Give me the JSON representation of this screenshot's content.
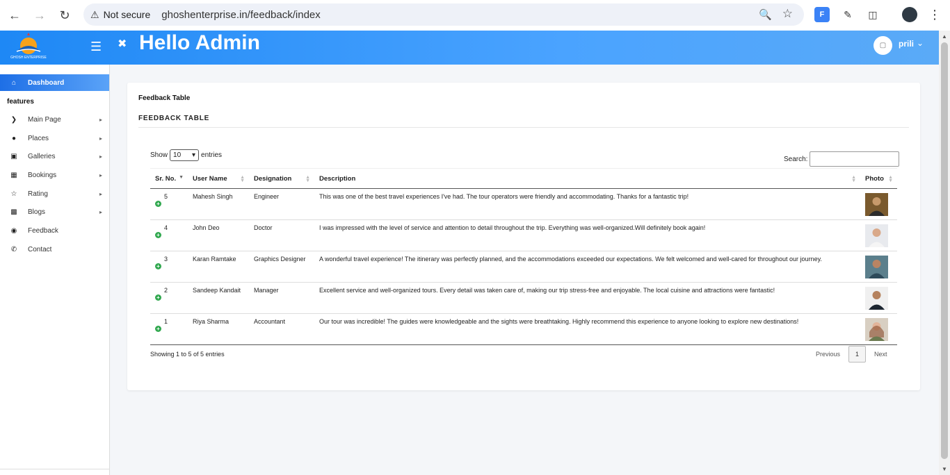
{
  "browser": {
    "not_secure": "Not secure",
    "url": "ghoshenterprise.in/feedback/index",
    "ext_label": "F"
  },
  "header": {
    "greeting": "Hello Admin",
    "user_name": "prili",
    "logo_text": "GHOSH ENTERPRISE"
  },
  "sidebar": {
    "section_label": "features",
    "items": [
      {
        "label": "Dashboard",
        "icon": "home-icon"
      },
      {
        "label": "Main Page",
        "icon": "chevron-right-icon"
      },
      {
        "label": "Places",
        "icon": "map-pin-icon"
      },
      {
        "label": "Galleries",
        "icon": "image-icon"
      },
      {
        "label": "Bookings",
        "icon": "calendar-icon"
      },
      {
        "label": "Rating",
        "icon": "star-icon"
      },
      {
        "label": "Blogs",
        "icon": "file-icon"
      },
      {
        "label": "Feedback",
        "icon": "comment-icon"
      },
      {
        "label": "Contact",
        "icon": "phone-icon"
      }
    ]
  },
  "card": {
    "breadcrumb": "Feedback Table",
    "title": "FEEDBACK TABLE"
  },
  "datatable": {
    "show_label": "Show",
    "entries_value": "10",
    "entries_label": "entries",
    "search_label": "Search:",
    "columns": [
      "Sr. No.",
      "User Name",
      "Designation",
      "Description",
      "Photo"
    ],
    "rows": [
      {
        "sr": "5",
        "name": "Mahesh Singh",
        "designation": "Engineer",
        "description": "This was one of the best travel experiences I've had. The tour operators were friendly and accommodating. Thanks for a fantastic trip!"
      },
      {
        "sr": "4",
        "name": "John Deo",
        "designation": "Doctor",
        "description": "I was impressed with the level of service and attention to detail throughout the trip. Everything was well-organized.Will definitely book again!"
      },
      {
        "sr": "3",
        "name": "Karan Ramtake",
        "designation": "Graphics Designer",
        "description": "A wonderful travel experience! The itinerary was perfectly planned, and the accommodations exceeded our expectations. We felt welcomed and well-cared for throughout our journey."
      },
      {
        "sr": "2",
        "name": "Sandeep Kandait",
        "designation": "Manager",
        "description": "Excellent service and well-organized tours. Every detail was taken care of, making our trip stress-free and enjoyable. The local cuisine and attractions were fantastic!"
      },
      {
        "sr": "1",
        "name": "Riya Sharma",
        "designation": "Accountant",
        "description": "Our tour was incredible! The guides were knowledgeable and the sights were breathtaking. Highly recommend this experience to anyone looking to explore new destinations!"
      }
    ],
    "info": "Showing 1 to 5 of 5 entries",
    "pagination": {
      "previous": "Previous",
      "current": "1",
      "next": "Next"
    }
  },
  "colors": {
    "header_start": "#1e88f5",
    "header_end": "#5aaaf7",
    "active_item": "#1e6fe6",
    "expand_green": "#31a84f"
  }
}
